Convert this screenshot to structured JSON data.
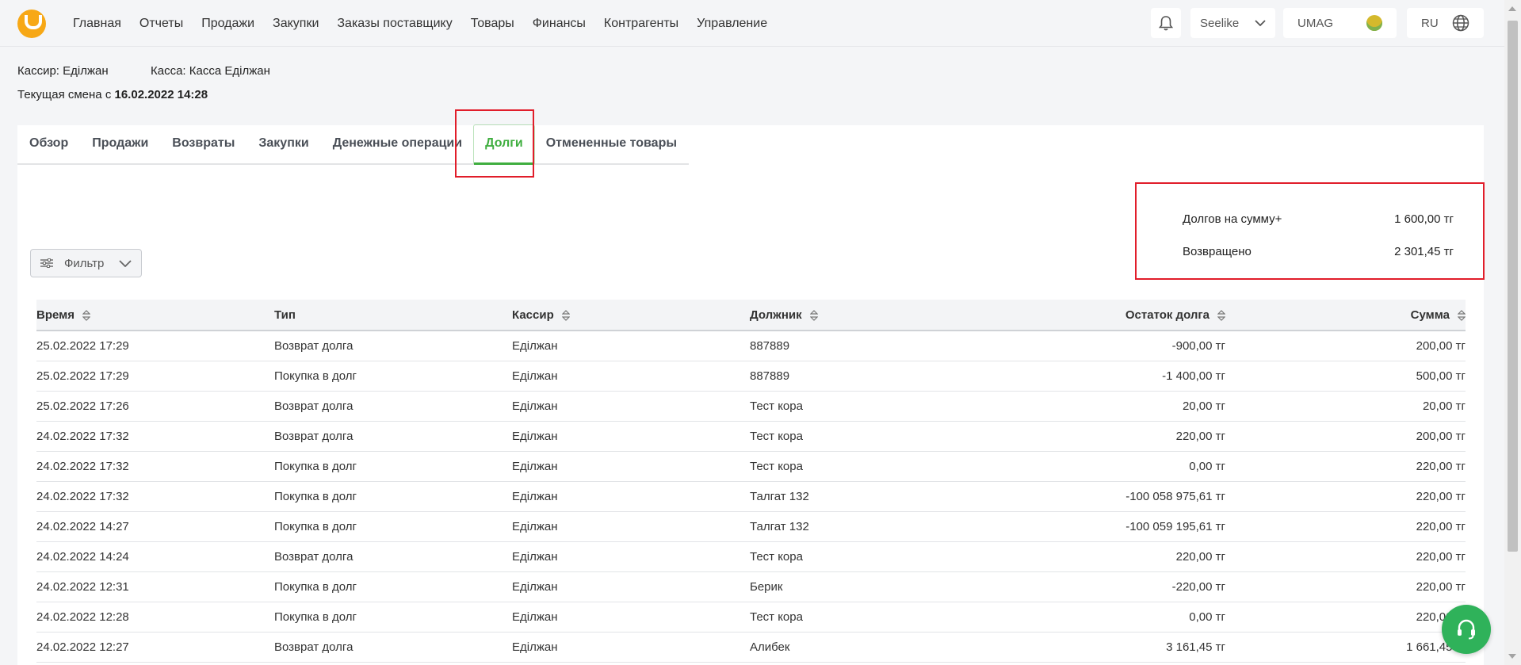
{
  "header": {
    "logo": "umag-logo",
    "nav": [
      "Главная",
      "Отчеты",
      "Продажи",
      "Закупки",
      "Заказы поставщику",
      "Товары",
      "Финансы",
      "Контрагенты",
      "Управление"
    ],
    "store": "Seelike",
    "user": "UMAG",
    "language": "RU"
  },
  "shift": {
    "cashier_label": "Кассир:",
    "cashier": "Еділжан",
    "register_label": "Касса:",
    "register": "Касса Еділжан",
    "shift_label": "Текущая смена с",
    "shift_start": "16.02.2022 14:28"
  },
  "tabs": [
    "Обзор",
    "Продажи",
    "Возвраты",
    "Закупки",
    "Денежные операции",
    "Долги",
    "Отмененные товары"
  ],
  "active_tab": "Долги",
  "summary": {
    "debts_label": "Долгов на сумму+",
    "debts_value": "1 600,00 тг",
    "returned_label": "Возвращено",
    "returned_value": "2 301,45 тг"
  },
  "filter_label": "Фильтр",
  "table": {
    "columns": [
      "Время",
      "Тип",
      "Кассир",
      "Должник",
      "Остаток долга",
      "Сумма"
    ],
    "rows": [
      [
        "25.02.2022 17:29",
        "Возврат долга",
        "Еділжан",
        "887889",
        "-900,00 тг",
        "200,00 тг"
      ],
      [
        "25.02.2022 17:29",
        "Покупка в долг",
        "Еділжан",
        "887889",
        "-1 400,00 тг",
        "500,00 тг"
      ],
      [
        "25.02.2022 17:26",
        "Возврат долга",
        "Еділжан",
        "Тест кора",
        "20,00 тг",
        "20,00 тг"
      ],
      [
        "24.02.2022 17:32",
        "Возврат долга",
        "Еділжан",
        "Тест кора",
        "220,00 тг",
        "200,00 тг"
      ],
      [
        "24.02.2022 17:32",
        "Покупка в долг",
        "Еділжан",
        "Тест кора",
        "0,00 тг",
        "220,00 тг"
      ],
      [
        "24.02.2022 17:32",
        "Покупка в долг",
        "Еділжан",
        "Талгат 132",
        "-100 058 975,61 тг",
        "220,00 тг"
      ],
      [
        "24.02.2022 14:27",
        "Покупка в долг",
        "Еділжан",
        "Талгат 132",
        "-100 059 195,61 тг",
        "220,00 тг"
      ],
      [
        "24.02.2022 14:24",
        "Возврат долга",
        "Еділжан",
        "Тест кора",
        "220,00 тг",
        "220,00 тг"
      ],
      [
        "24.02.2022 12:31",
        "Покупка в долг",
        "Еділжан",
        "Берик",
        "-220,00 тг",
        "220,00 тг"
      ],
      [
        "24.02.2022 12:28",
        "Покупка в долг",
        "Еділжан",
        "Тест кора",
        "0,00 тг",
        "220,00 тг"
      ],
      [
        "24.02.2022 12:27",
        "Возврат долга",
        "Еділжан",
        "Алибек",
        "3 161,45 тг",
        "1 661,45 тг"
      ]
    ]
  },
  "colors": {
    "accent_green": "#3fae3f",
    "highlight_red": "#e11d2a",
    "logo_orange": "#f7a816",
    "support_green": "#2fb25a"
  }
}
